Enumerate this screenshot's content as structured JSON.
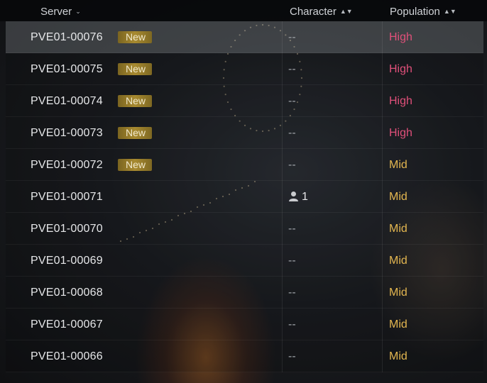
{
  "colors": {
    "high": "#e0507a",
    "mid": "#e3b650",
    "badge": "#a88a30"
  },
  "header": {
    "server_label": "Server",
    "character_label": "Character",
    "population_label": "Population",
    "server_sort_icon": "chevron-down-icon",
    "sort_icon": "sort-arrows-icon"
  },
  "rows": [
    {
      "server": "PVE01-00076",
      "badge": "New",
      "character": "--",
      "population": "High",
      "selected": true
    },
    {
      "server": "PVE01-00075",
      "badge": "New",
      "character": "--",
      "population": "High"
    },
    {
      "server": "PVE01-00074",
      "badge": "New",
      "character": "--",
      "population": "High"
    },
    {
      "server": "PVE01-00073",
      "badge": "New",
      "character": "--",
      "population": "High"
    },
    {
      "server": "PVE01-00072",
      "badge": "New",
      "character": "--",
      "population": "Mid"
    },
    {
      "server": "PVE01-00071",
      "badge": "",
      "character": "1",
      "character_icon": "user-icon",
      "population": "Mid"
    },
    {
      "server": "PVE01-00070",
      "badge": "",
      "character": "--",
      "population": "Mid"
    },
    {
      "server": "PVE01-00069",
      "badge": "",
      "character": "--",
      "population": "Mid"
    },
    {
      "server": "PVE01-00068",
      "badge": "",
      "character": "--",
      "population": "Mid"
    },
    {
      "server": "PVE01-00067",
      "badge": "",
      "character": "--",
      "population": "Mid"
    },
    {
      "server": "PVE01-00066",
      "badge": "",
      "character": "--",
      "population": "Mid"
    }
  ]
}
